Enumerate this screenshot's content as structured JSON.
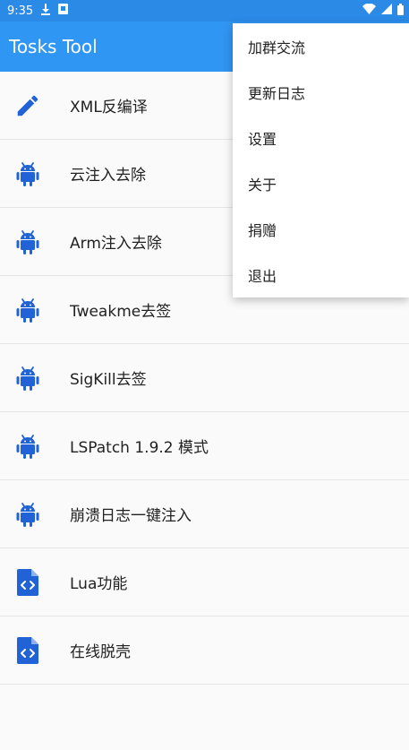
{
  "status_bar": {
    "time": "9:35",
    "icons_left": [
      "download-icon",
      "notification-icon"
    ],
    "icons_right": [
      "wifi-icon",
      "signal-icon",
      "battery-icon"
    ]
  },
  "app_bar": {
    "title": "Tosks Tool"
  },
  "colors": {
    "primary": "#3096f3",
    "status_bar": "#2a8ae6",
    "icon_blue": "#2162d6"
  },
  "list": [
    {
      "label": "XML反编译",
      "icon": "pencil-icon"
    },
    {
      "label": "云注入去除",
      "icon": "android-icon"
    },
    {
      "label": "Arm注入去除",
      "icon": "android-icon"
    },
    {
      "label": "Tweakme去签",
      "icon": "android-icon"
    },
    {
      "label": "SigKill去签",
      "icon": "android-icon"
    },
    {
      "label": "LSPatch 1.9.2 模式",
      "icon": "android-icon"
    },
    {
      "label": "崩溃日志一键注入",
      "icon": "android-icon"
    },
    {
      "label": "Lua功能",
      "icon": "code-file-icon"
    },
    {
      "label": "在线脱壳",
      "icon": "code-file-icon"
    }
  ],
  "overflow_menu": {
    "items": [
      "加群交流",
      "更新日志",
      "设置",
      "关于",
      "捐赠",
      "退出"
    ]
  }
}
